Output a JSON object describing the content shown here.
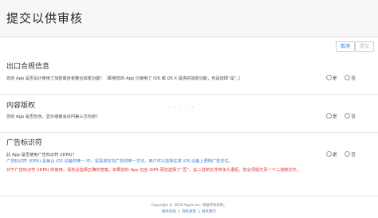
{
  "header": {
    "title": "提交以供审核"
  },
  "toolbar": {
    "cancel_label": "取消",
    "submit_label": "提交"
  },
  "export": {
    "title": "出口合规信息",
    "question": "您的 App 是否设计使用了加密或含有整合加密功能？（即使您的 App 只使用了 iOS 或 OS X 提供的加密功能，也请选择“是”。）",
    "yes": "是",
    "no": "否"
  },
  "content": {
    "title": "内容版权",
    "question": "您的 App 是否包含、显示或者会访问第三方内容？",
    "yes": "是",
    "no": "否"
  },
  "idfa": {
    "title": "广告标识符",
    "question": "此 App 是否使用广告标识符 (IDFA)？",
    "info": "广告标识符 (IDFA) 是每台 iOS 设备的唯一 ID，是投放定向广告的唯一方法。用户可以选择在其 iOS 设备上限制广告定位。",
    "warning": "对于广告标识符 (IDFA) 的使用，请务必选择正确的答案。如果您的 App 包含 IDFA 而您选择了“否”，此二进制文件将永久遭拒，您必须提交另一个二进制文件。",
    "yes": "是",
    "no": "否"
  },
  "footer": {
    "copyright": "Copyright © 2016 Apple Inc. 保留所有权利。",
    "links": [
      "服务条款",
      "隐私政策",
      "联系我们"
    ]
  },
  "colors": {
    "link_blue": "#3f82d1",
    "warning_red": "#e0322d"
  }
}
